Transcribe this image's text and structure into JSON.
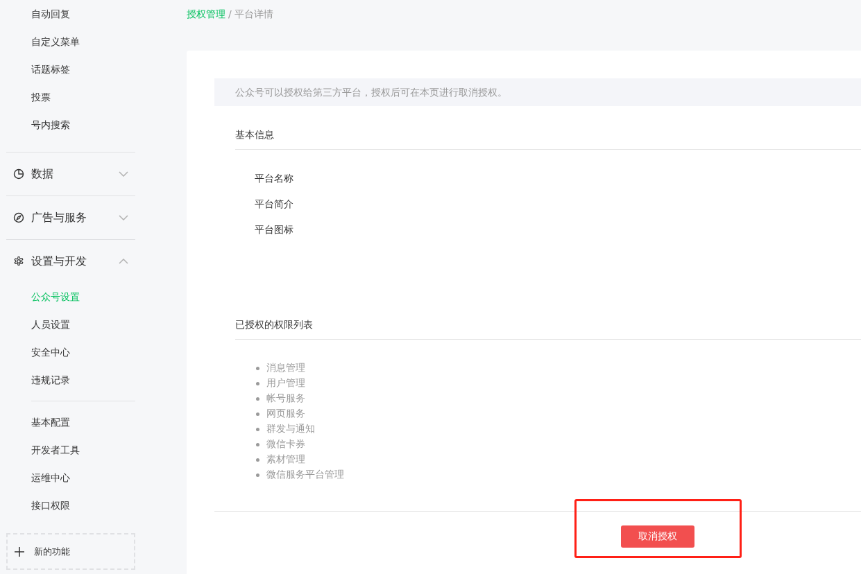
{
  "sidebar": {
    "items": [
      {
        "label": "自动回复",
        "selected": false
      },
      {
        "label": "自定义菜单",
        "selected": false
      },
      {
        "label": "话题标签",
        "selected": false
      },
      {
        "label": "投票",
        "selected": false
      },
      {
        "label": "号内搜索",
        "selected": false
      }
    ],
    "groups": [
      {
        "kind": "chart",
        "label": "数据",
        "expanded": false
      },
      {
        "kind": "compass",
        "label": "广告与服务",
        "expanded": false
      },
      {
        "kind": "gear",
        "label": "设置与开发",
        "expanded": true,
        "sections": [
          [
            {
              "label": "公众号设置",
              "selected": true
            },
            {
              "label": "人员设置",
              "selected": false
            },
            {
              "label": "安全中心",
              "selected": false
            },
            {
              "label": "违规记录",
              "selected": false
            }
          ],
          [
            {
              "label": "基本配置",
              "selected": false
            },
            {
              "label": "开发者工具",
              "selected": false
            },
            {
              "label": "运维中心",
              "selected": false
            },
            {
              "label": "接口权限",
              "selected": false
            }
          ]
        ]
      }
    ],
    "new_feature": {
      "label": "新的功能"
    }
  },
  "breadcrumb": [
    {
      "label": "授权管理",
      "link": true
    },
    {
      "label": "平台详情",
      "link": false
    }
  ],
  "breadcrumb_separator": "/",
  "notice": "公众号可以授权给第三方平台，授权后可在本页进行取消授权。",
  "basic_info": {
    "title": "基本信息",
    "fields": [
      "平台名称",
      "平台简介",
      "平台图标"
    ]
  },
  "permissions": {
    "title": "已授权的权限列表",
    "items": [
      "消息管理",
      "用户管理",
      "帐号服务",
      "网页服务",
      "群发与通知",
      "微信卡券",
      "素材管理",
      "微信服务平台管理"
    ]
  },
  "cancel_button": {
    "label": "取消授权",
    "highlighted": true
  }
}
